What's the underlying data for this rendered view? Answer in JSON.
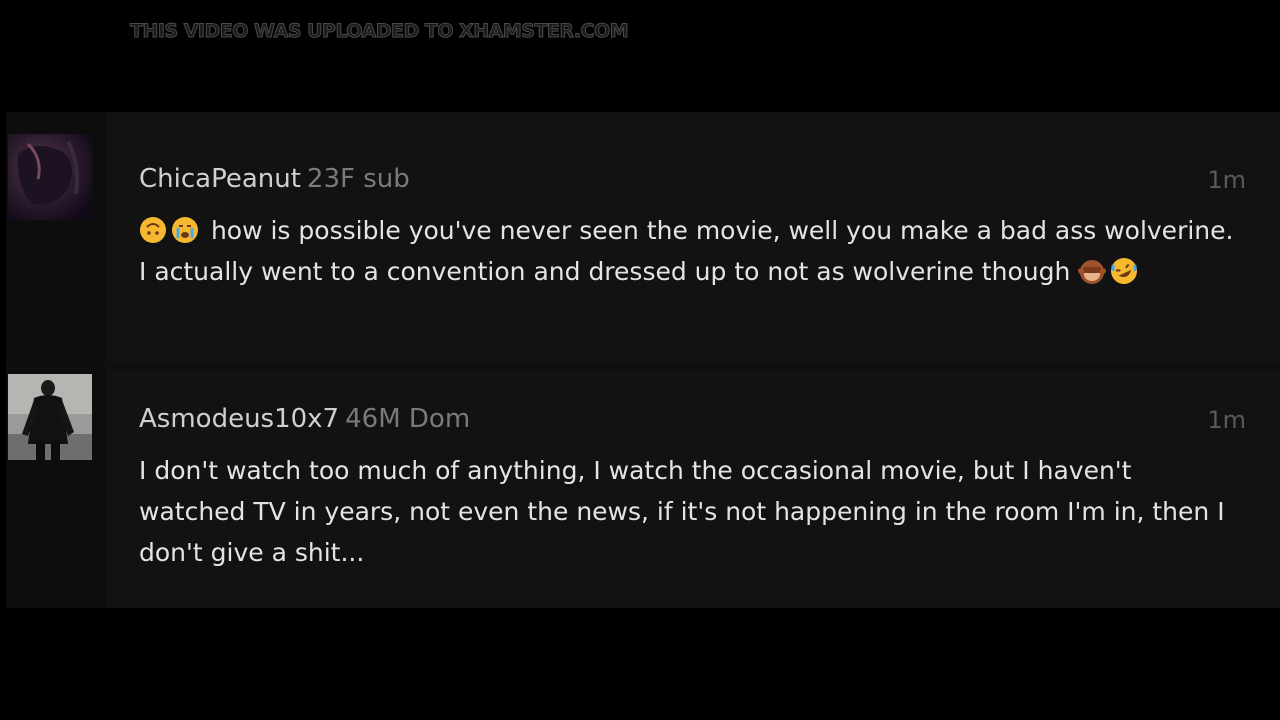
{
  "watermark": "THIS VIDEO WAS UPLOADED TO XHAMSTER.COM",
  "comments": [
    {
      "username": "ChicaPeanut",
      "tags": "23F sub",
      "time": "1m",
      "lead_emojis": [
        "upside-down-face-emoji",
        "crying-face-emoji"
      ],
      "text": "how is possible you've never seen the movie, well you make a bad ass wolverine. I actually went to a convention and dressed up to not as wolverine though",
      "trail_emojis": [
        "see-no-evil-monkey-emoji",
        "rofl-emoji"
      ]
    },
    {
      "username": "Asmodeus10x7",
      "tags": "46M Dom",
      "time": "1m",
      "text": "I don't watch too much of anything, I watch the occasional movie, but I haven't watched TV in years, not even the news, if it's not happening in the room I'm in, then I don't give a shit..."
    }
  ],
  "colors": {
    "background": "#000000",
    "card": "#121212",
    "username": "#d0d0d0",
    "tags": "#7a7a7a",
    "body_text": "#e4e4e4",
    "time": "#5a5a5a"
  }
}
